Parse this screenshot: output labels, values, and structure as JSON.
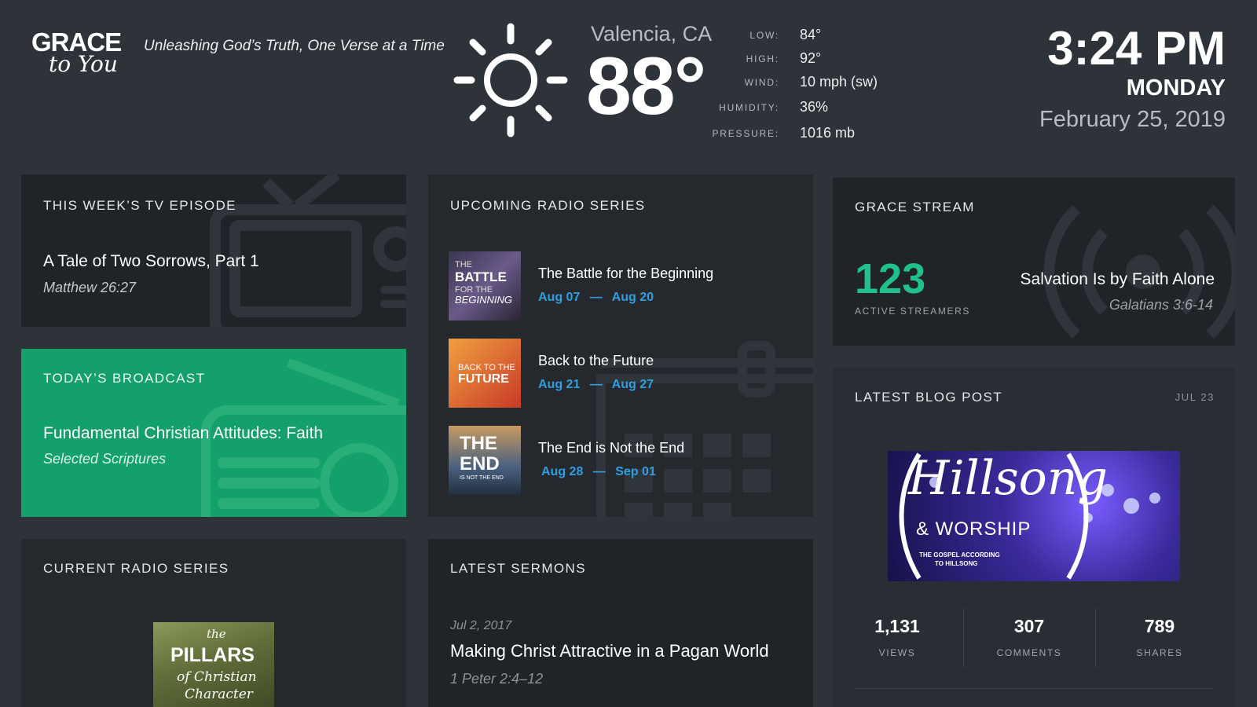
{
  "header": {
    "logo_line1": "GRACE",
    "logo_line2": "to You",
    "tagline": "Unleashing God’s Truth, One Verse at a Time"
  },
  "weather": {
    "icon": "sun-icon",
    "city": "Valencia, CA",
    "temperature": "88°",
    "details": [
      {
        "label": "LOW:",
        "value": "84°"
      },
      {
        "label": "HIGH:",
        "value": "92°"
      },
      {
        "label": "WIND:",
        "value": "10 mph (sw)"
      },
      {
        "label": "HUMIDITY:",
        "value": "36%"
      },
      {
        "label": "PRESSURE:",
        "value": "1016 mb"
      }
    ]
  },
  "clock": {
    "time": "3:24 PM",
    "day": "MONDAY",
    "date": "February 25,  2019"
  },
  "tv_episode": {
    "heading": "THIS WEEK’S TV EPISODE",
    "title": "A Tale of Two Sorrows, Part 1",
    "reference": "Matthew 26:27",
    "icon": "television-icon"
  },
  "broadcast": {
    "heading": "TODAY’S BROADCAST",
    "title": "Fundamental Christian Attitudes: Faith",
    "reference": "Selected Scriptures",
    "icon": "radio-icon",
    "color": "#14a06a"
  },
  "upcoming_radio": {
    "heading": "UPCOMING RADIO SERIES",
    "icon": "calendar-icon",
    "items": [
      {
        "cover": "THE BATTLE FOR THE BEGINNING",
        "title": "The Battle for the Beginning",
        "start": "Aug 07",
        "end": "Aug 20"
      },
      {
        "cover": "BACK TO THE FUTURE",
        "title": "Back to the Future",
        "start": "Aug 21",
        "end": "Aug 27"
      },
      {
        "cover": "THE END IS NOT THE END",
        "title": "The End is Not the End",
        "start": "Aug 28",
        "end": "Sep 01"
      }
    ],
    "date_separator": "—",
    "accent": "#2d9fe0"
  },
  "grace_stream": {
    "heading": "GRACE STREAM",
    "count": "123",
    "count_label": "ACTIVE STREAMERS",
    "title": "Salvation Is by Faith Alone",
    "reference": "Galatians 3:6-14",
    "icon": "broadcast-icon",
    "accent": "#20c08a"
  },
  "blog": {
    "heading": "LATEST BLOG POST",
    "date": "JUL 23",
    "image_text": "Hillsong",
    "image_sub": "& WORSHIP",
    "image_caption_1": "THE GOSPEL ACCORDING",
    "image_caption_2": "TO HILLSONG",
    "stats": [
      {
        "value": "1,131",
        "label": "VIEWS"
      },
      {
        "value": "307",
        "label": "COMMENTS"
      },
      {
        "value": "789",
        "label": "SHARES"
      }
    ]
  },
  "current_radio": {
    "heading": "CURRENT RADIO SERIES",
    "cover_line1": "the",
    "cover_line2": "PILLARS",
    "cover_line3": "of Christian",
    "cover_line4": "Character"
  },
  "sermons": {
    "heading": "LATEST SERMONS",
    "date": "Jul 2, 2017",
    "title": "Making Christ Attractive in a Pagan World",
    "reference": "1 Peter 2:4–12"
  }
}
